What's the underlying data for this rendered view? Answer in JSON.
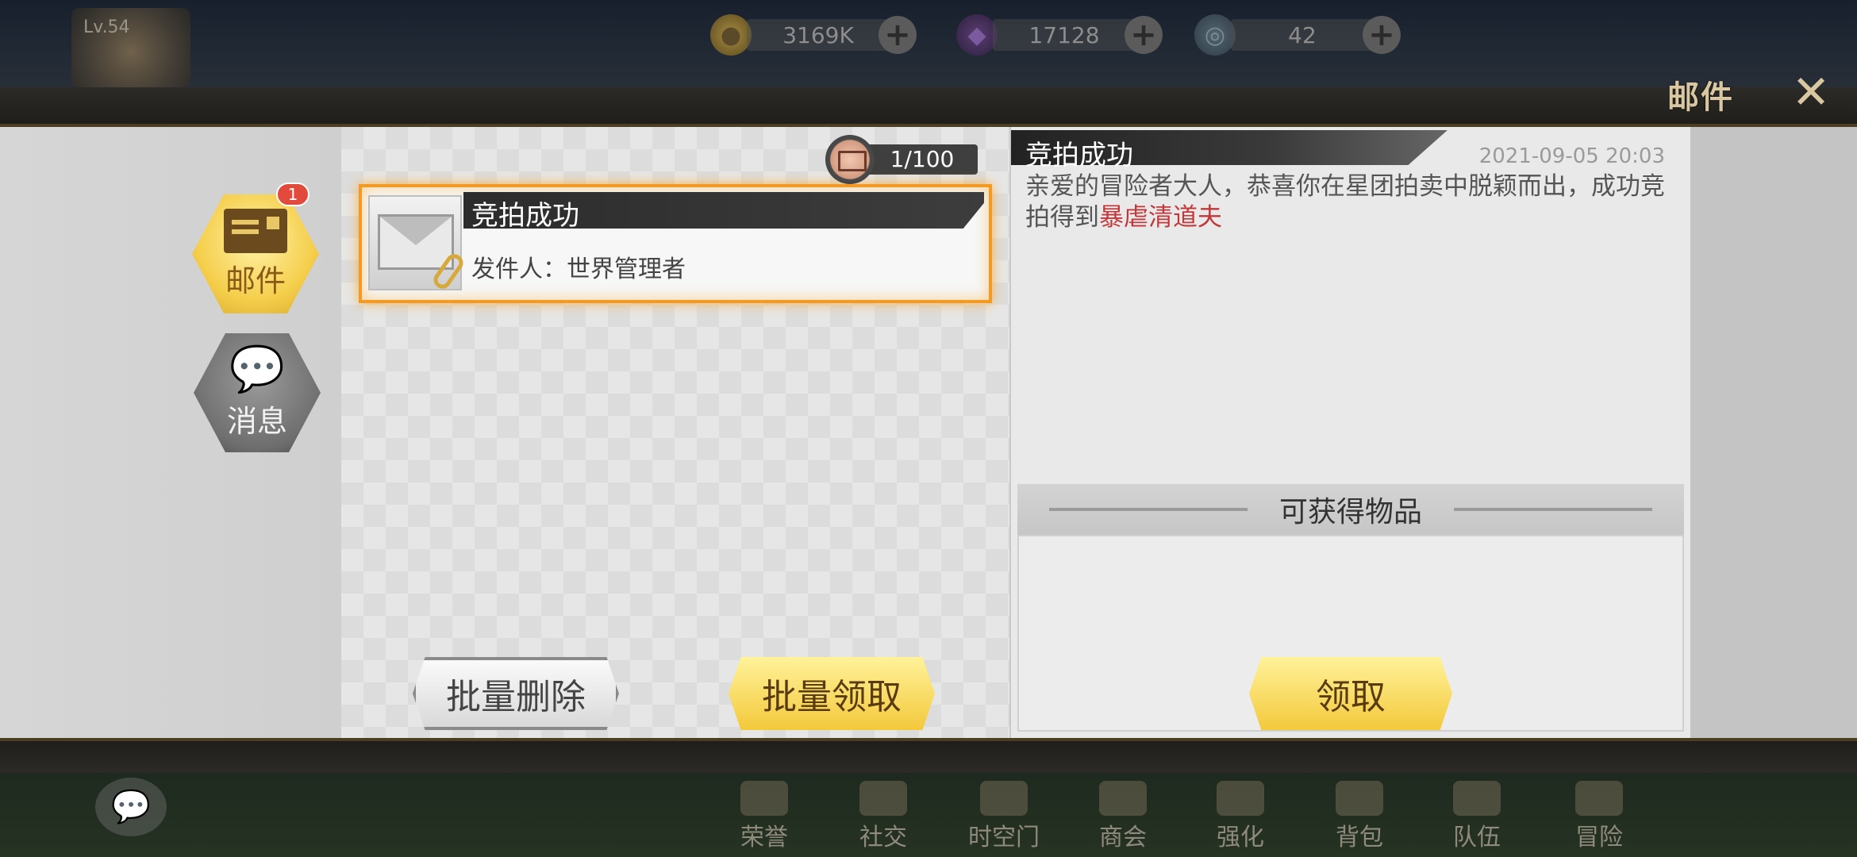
{
  "hud": {
    "level": "Lv.54",
    "gold": "3169K",
    "gems": "17128",
    "tokens": "42",
    "plus": "+"
  },
  "window": {
    "title": "邮件",
    "close": "✕"
  },
  "tabs": {
    "mail_label": "邮件",
    "mail_badge": "1",
    "message_label": "消息"
  },
  "mail_list": {
    "count": "1/100",
    "items": [
      {
        "title": "竞拍成功",
        "sender": "发件人：世界管理者"
      }
    ],
    "batch_delete": "批量删除",
    "batch_claim": "批量领取"
  },
  "detail": {
    "title": "竞拍成功",
    "date": "2021-09-05  20:03",
    "body": "亲爱的冒险者大人，恭喜你在星团拍卖中脱颖而出，成功竞拍得到",
    "highlight": "暴虐清道夫",
    "rewards_title": "可获得物品",
    "claim": "领取"
  },
  "bottom_nav": {
    "honor": "荣誉",
    "social": "社交",
    "gate": "时空门",
    "guild": "商会",
    "enhance": "强化",
    "bag": "背包",
    "team": "队伍",
    "adventure": "冒险"
  },
  "colors": {
    "accent_gold": "#f3c93b",
    "highlight_red": "#c2383a",
    "selected_border": "#f39a26"
  }
}
